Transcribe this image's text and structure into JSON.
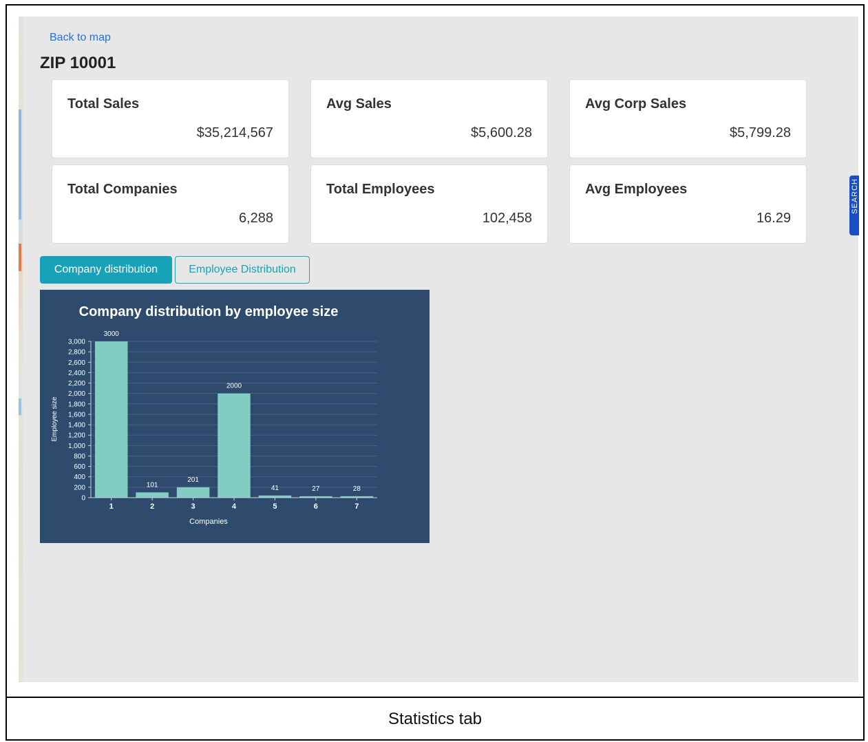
{
  "back_link": "Back to map",
  "zip_title": "ZIP 10001",
  "cards": [
    {
      "label": "Total Sales",
      "value": "$35,214,567"
    },
    {
      "label": "Avg Sales",
      "value": "$5,600.28"
    },
    {
      "label": "Avg Corp Sales",
      "value": "$5,799.28"
    },
    {
      "label": "Total Companies",
      "value": "6,288"
    },
    {
      "label": "Total Employees",
      "value": "102,458"
    },
    {
      "label": "Avg Employees",
      "value": "16.29"
    }
  ],
  "tabs": {
    "company": "Company distribution",
    "employee": "Employee Distribution"
  },
  "side_tab": "SEARCH",
  "caption": "Statistics tab",
  "colors": {
    "panel": "#e7e7e7",
    "accent": "#17a2b8",
    "chart_bg": "#2e4a6c",
    "bar": "#82ccc4",
    "side_tab": "#1a4fc4"
  },
  "chart_data": {
    "type": "bar",
    "title": "Company distribution by employee size",
    "xlabel": "Companies",
    "ylabel": "Employee size",
    "categories": [
      "1",
      "2",
      "3",
      "4",
      "5",
      "6",
      "7"
    ],
    "values": [
      3000,
      101,
      201,
      2000,
      41,
      27,
      28
    ],
    "ylim": [
      0,
      3000
    ],
    "yticks": [
      0,
      200,
      400,
      600,
      800,
      1000,
      1200,
      1400,
      1600,
      1800,
      2000,
      2200,
      2400,
      2600,
      2800,
      3000
    ],
    "grid": true,
    "legend": false
  }
}
